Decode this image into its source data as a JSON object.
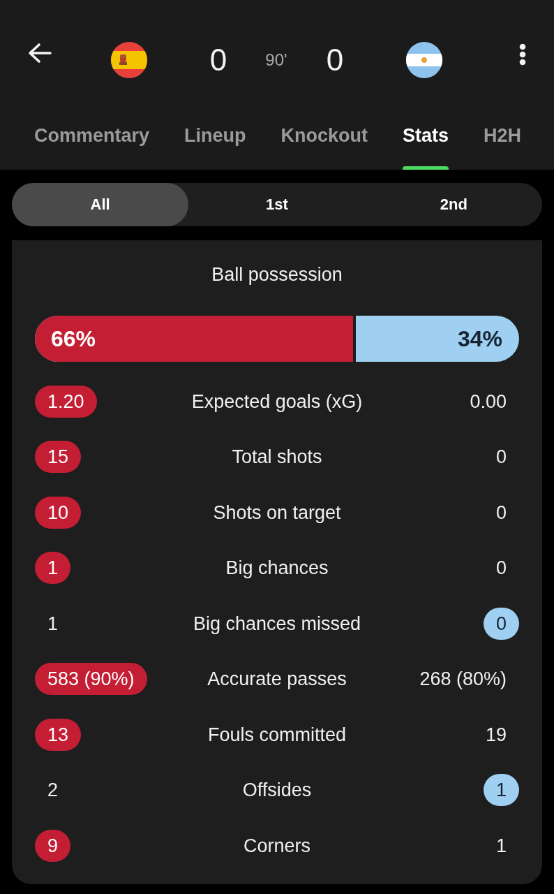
{
  "match": {
    "minute": "90'"
  },
  "teams": [
    {
      "score": "0",
      "color": "#c41e34"
    },
    {
      "score": "0",
      "color": "#9fd0f2"
    }
  ],
  "tabs": [
    {
      "label": "Commentary",
      "selected": false
    },
    {
      "label": "Lineup",
      "selected": false
    },
    {
      "label": "Knockout",
      "selected": false
    },
    {
      "label": "Stats",
      "selected": true
    },
    {
      "label": "H2H",
      "selected": false
    }
  ],
  "periods": [
    {
      "label": "All",
      "selected": true
    },
    {
      "label": "1st",
      "selected": false
    },
    {
      "label": "2nd",
      "selected": false
    }
  ],
  "possession": {
    "title": "Ball possession",
    "home": "66%",
    "away": "34%",
    "level": 0.66
  },
  "stats": [
    {
      "label": "Expected goals (xG)",
      "home": {
        "value": "1.20",
        "highlighted": true
      },
      "away": {
        "value": "0.00",
        "highlighted": false
      }
    },
    {
      "label": "Total shots",
      "home": {
        "value": "15",
        "highlighted": true
      },
      "away": {
        "value": "0",
        "highlighted": false
      }
    },
    {
      "label": "Shots on target",
      "home": {
        "value": "10",
        "highlighted": true
      },
      "away": {
        "value": "0",
        "highlighted": false
      }
    },
    {
      "label": "Big chances",
      "home": {
        "value": "1",
        "highlighted": true
      },
      "away": {
        "value": "0",
        "highlighted": false
      }
    },
    {
      "label": "Big chances missed",
      "home": {
        "value": "1",
        "highlighted": false
      },
      "away": {
        "value": "0",
        "highlighted": true
      }
    },
    {
      "label": "Accurate passes",
      "home": {
        "value": "583 (90%)",
        "highlighted": true
      },
      "away": {
        "value": "268 (80%)",
        "highlighted": false
      }
    },
    {
      "label": "Fouls committed",
      "home": {
        "value": "13",
        "highlighted": true
      },
      "away": {
        "value": "19",
        "highlighted": false
      }
    },
    {
      "label": "Offsides",
      "home": {
        "value": "2",
        "highlighted": false
      },
      "away": {
        "value": "1",
        "highlighted": true
      }
    },
    {
      "label": "Corners",
      "home": {
        "value": "9",
        "highlighted": true
      },
      "away": {
        "value": "1",
        "highlighted": false
      }
    }
  ]
}
